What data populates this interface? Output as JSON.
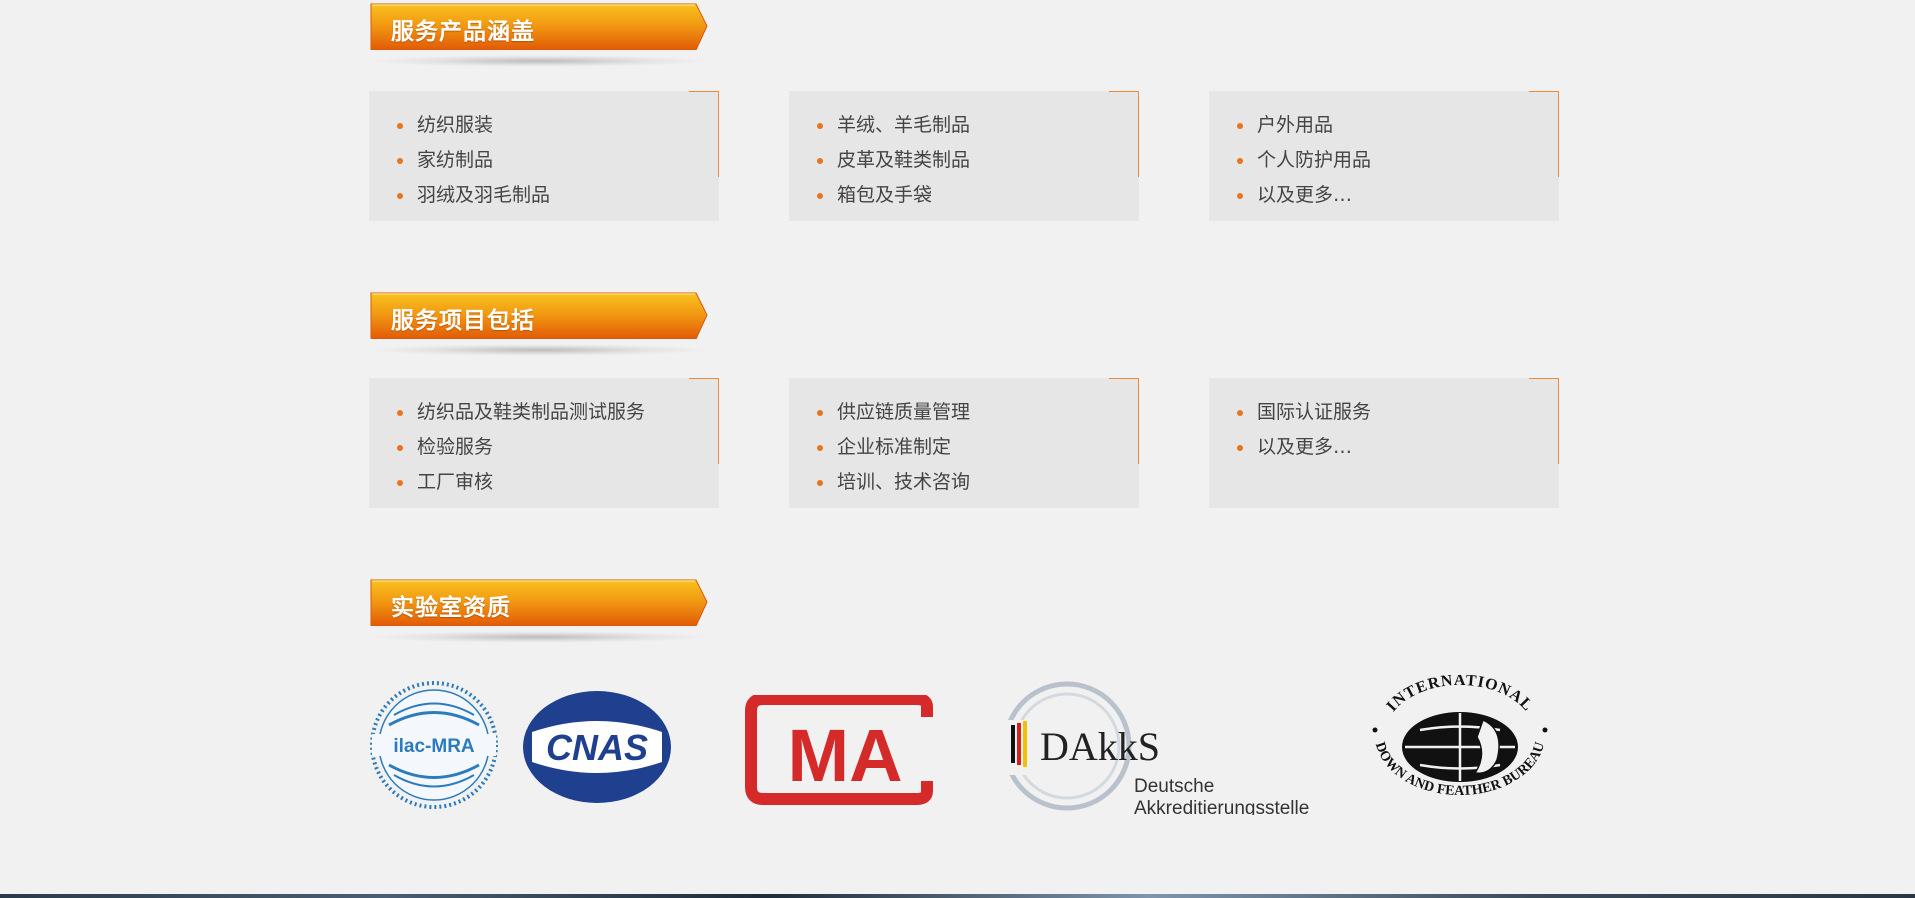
{
  "sections": [
    {
      "title": "服务产品涵盖",
      "cards": [
        {
          "items": [
            "纺织服装",
            "家纺制品",
            "羽绒及羽毛制品"
          ]
        },
        {
          "items": [
            "羊绒、羊毛制品",
            "皮革及鞋类制品",
            "箱包及手袋"
          ]
        },
        {
          "items": [
            "户外用品",
            "个人防护用品",
            "以及更多…"
          ]
        }
      ]
    },
    {
      "title": "服务项目包括",
      "cards": [
        {
          "items": [
            "纺织品及鞋类制品测试服务",
            "检验服务",
            "工厂审核"
          ]
        },
        {
          "items": [
            "供应链质量管理",
            "企业标准制定",
            "培训、技术咨询"
          ]
        },
        {
          "items": [
            "国际认证服务",
            "以及更多…"
          ]
        }
      ]
    },
    {
      "title": "实验室资质"
    }
  ],
  "logos": {
    "ilac": {
      "text": "ilac-MRA"
    },
    "cnas": {
      "text": "CNAS"
    },
    "cma": {
      "text": "MA"
    },
    "dakks": {
      "name": "DAkkS",
      "line1": "Deutsche",
      "line2": "Akkreditierungsstelle"
    },
    "idfb": {
      "top": "INTERNATIONAL",
      "bottom": "DOWN AND FEATHER BUREAU"
    }
  },
  "colors": {
    "accent": "#e8741e",
    "ribbon_top": "#f7b21b",
    "ribbon_bottom": "#e55c07",
    "card_bg": "#e6e6e6",
    "page_bg": "#f1f1f1"
  }
}
